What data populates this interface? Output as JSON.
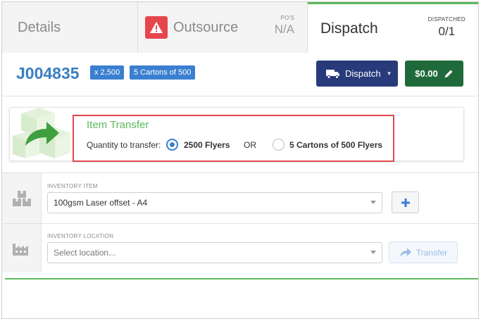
{
  "tabs": {
    "details": {
      "label": "Details"
    },
    "outsource": {
      "label": "Outsource",
      "pos_label": "PO'S",
      "pos_value": "N/A"
    },
    "dispatch": {
      "label": "Dispatch",
      "dispatched_label": "DISPATCHED",
      "dispatched_value": "0/1"
    }
  },
  "job": {
    "number": "J004835",
    "qty_tag": "x 2,500",
    "cartons_tag": "5 Cartons of 500",
    "dispatch_button": "Dispatch",
    "price_button": "$0.00"
  },
  "transfer": {
    "title": "Item Transfer",
    "quantity_label": "Quantity to transfer:",
    "option_1": "2500 Flyers",
    "or_label": "OR",
    "option_2": "5 Cartons of 500 Flyers",
    "selected": "option_1"
  },
  "inventory": {
    "item_label": "INVENTORY ITEM",
    "item_value": "100gsm Laser offset - A4",
    "location_label": "INVENTORY LOCATION",
    "location_placeholder": "Select location...",
    "transfer_button": "Transfer"
  },
  "colors": {
    "accent_green": "#5cb85c",
    "job_blue": "#3a7fc1",
    "dispatch_navy": "#283a7a",
    "price_green": "#1f6a3a",
    "warning_red": "#e5464c",
    "highlight_red": "#e0464c"
  },
  "icons": {
    "outsource": "warning-icon",
    "dispatch": "truck-icon",
    "price": "pencil-icon",
    "transfer_card": "box-transfer-icon",
    "item_row": "boxes-icon",
    "location_row": "factory-icon",
    "add": "plus-icon",
    "transfer": "share-arrow-icon"
  }
}
